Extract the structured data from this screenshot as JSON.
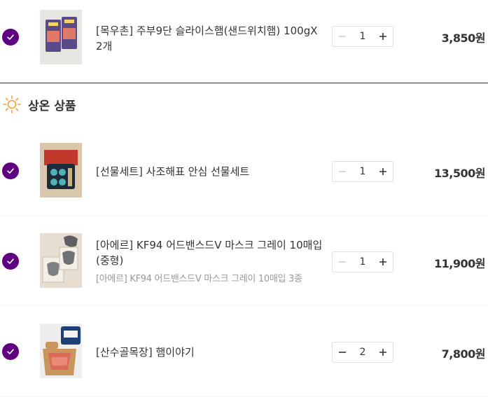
{
  "colors": {
    "accent": "#5f0080",
    "sun_orange": "#f29f3d",
    "text": "#333333",
    "subtext": "#999999"
  },
  "section_room_temp": {
    "label": "상온 상품",
    "icon": "sun-icon"
  },
  "items": [
    {
      "title": "[목우촌] 주부9단 슬라이스햄(샌드위치햄) 100gX 2개",
      "subtitle": "",
      "quantity": "1",
      "price": "3,850원",
      "checked": true,
      "minus_enabled": false
    },
    {
      "title": "[선물세트] 사조해표 안심 선물세트",
      "subtitle": "",
      "quantity": "1",
      "price": "13,500원",
      "checked": true,
      "minus_enabled": false
    },
    {
      "title": "[아에르] KF94 어드밴스드V 마스크 그레이 10매입 (중형)",
      "subtitle": "[아에르] KF94 어드밴스드V 마스크 그레이 10매입 3종",
      "quantity": "1",
      "price": "11,900원",
      "checked": true,
      "minus_enabled": false
    },
    {
      "title": "[산수골목장] 햄이야기",
      "subtitle": "",
      "quantity": "2",
      "price": "7,800원",
      "checked": true,
      "minus_enabled": true
    }
  ]
}
